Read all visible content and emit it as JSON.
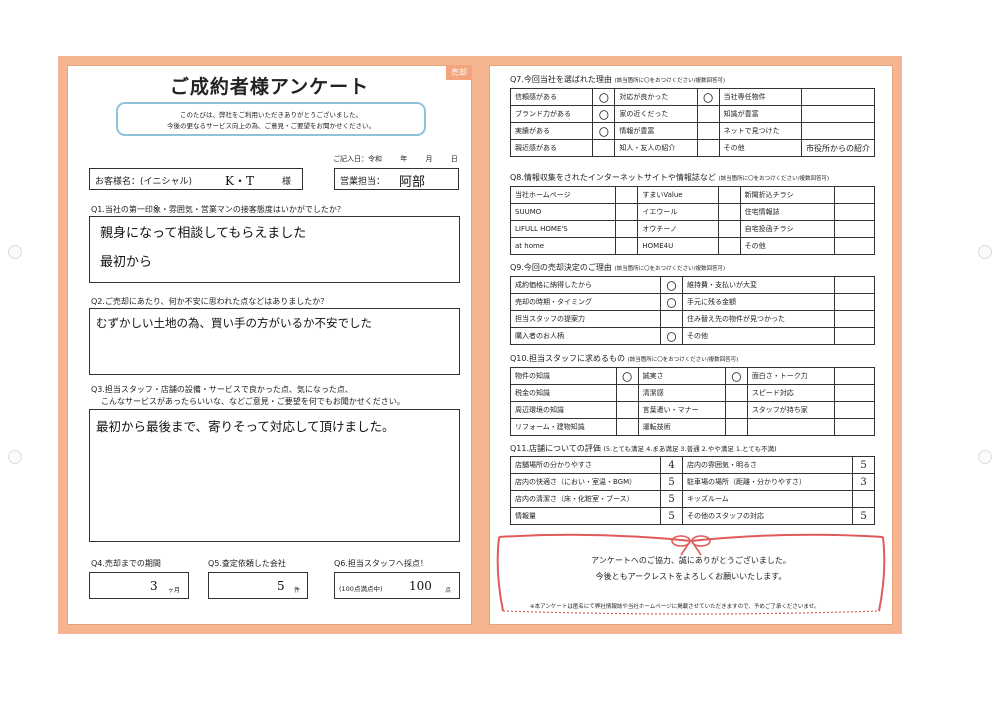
{
  "survey_title": "ご成約者様アンケート",
  "corner_tag": "売却",
  "intro": [
    "このたびは、弊社をご利用いただきありがとうございました。",
    "今後の更なるサービス向上の為、ご意見・ご要望をお聞かせください。"
  ],
  "entry_date": {
    "label": "ご記入日：令和",
    "year": "年",
    "month": "月",
    "day": "日"
  },
  "customer": {
    "label": "お客様名：(イニシャル)",
    "value": "K・T",
    "suffix": "様"
  },
  "staff": {
    "label": "営業担当：",
    "value": "阿部"
  },
  "q1": {
    "text": "Q1.当社の第一印象・雰囲気・営業マンの接客態度はいかがでしたか？",
    "answer": [
      "親身になって相談してもらえました",
      "最初から"
    ]
  },
  "q2": {
    "text": "Q2.ご売却にあたり、何か不安に思われた点などはありましたか？",
    "answer": "むずかしい土地の為、買い手の方がいるか不安でした"
  },
  "q3": {
    "text": "Q3.担当スタッフ・店舗の設備・サービスで良かった点、気になった点、",
    "text2": "こんなサービスがあったらいいな、などご意見・ご要望を何でもお聞かせください。",
    "answer": "最初から最後まで、寄りそって対応して頂けました。"
  },
  "q4": {
    "text": "Q4.売却までの期間",
    "value": "3",
    "unit": "ヶ月"
  },
  "q5": {
    "text": "Q5.査定依頼した会社",
    "value": "5",
    "unit": "件"
  },
  "q6": {
    "text": "Q6.担当スタッフへ採点！",
    "prefix": "(100点満点中)",
    "value": "100",
    "unit": "点"
  },
  "q7": {
    "text": "Q7.今回当社を選ばれた理由",
    "note": "(該当箇所に〇をおつけください/複数回答可)",
    "rows": [
      [
        "信頼感がある",
        "〇",
        "対応が良かった",
        "〇",
        "当社専任物件",
        ""
      ],
      [
        "ブランド力がある",
        "〇",
        "家の近くだった",
        "",
        "知識が豊富",
        ""
      ],
      [
        "実績がある",
        "〇",
        "情報が豊富",
        "",
        "ネットで見つけた",
        ""
      ],
      [
        "親近感がある",
        "",
        "知人・友人の紹介",
        "",
        "その他",
        "市役所からの紹介"
      ]
    ]
  },
  "q8": {
    "text": "Q8.情報収集をされたインターネットサイトや情報誌など",
    "note": "(該当箇所に〇をおつけください/複数回答可)",
    "rows": [
      [
        "当社ホームページ",
        "",
        "すまいValue",
        "",
        "新聞折込チラシ",
        ""
      ],
      [
        "SUUMO",
        "",
        "イエウール",
        "",
        "住宅情報誌",
        ""
      ],
      [
        "LIFULL HOME'S",
        "",
        "オウチーノ",
        "",
        "自宅投函チラシ",
        ""
      ],
      [
        "at home",
        "",
        "HOME4U",
        "",
        "その他",
        ""
      ]
    ]
  },
  "q9": {
    "text": "Q9.今回の売却決定のご理由",
    "note": "(該当箇所に〇をおつけください/複数回答可)",
    "rows": [
      [
        "成約価格に納得したから",
        "〇",
        "維持費・支払いが大変",
        ""
      ],
      [
        "売却の時期・タイミング",
        "〇",
        "手元に残る金額",
        ""
      ],
      [
        "担当スタッフの提案力",
        "",
        "住み替え先の物件が見つかった",
        ""
      ],
      [
        "購入者のお人柄",
        "〇",
        "その他",
        ""
      ]
    ]
  },
  "q10": {
    "text": "Q10.担当スタッフに求めるもの",
    "note": "(該当箇所に〇をおつけください/複数回答可)",
    "rows": [
      [
        "物件の知識",
        "〇",
        "誠実さ",
        "〇",
        "面白さ・トーク力",
        ""
      ],
      [
        "税金の知識",
        "",
        "清潔感",
        "",
        "スピード対応",
        ""
      ],
      [
        "周辺環境の知識",
        "",
        "言葉遣い・マナー",
        "",
        "スタッフが持ち家",
        ""
      ],
      [
        "リフォーム・建物知識",
        "",
        "運転技術",
        "",
        "",
        ""
      ]
    ]
  },
  "q11": {
    "text": "Q11.店舗についての評価",
    "scale": "(5.とても満足 4.まあ満足 3.普通 2.やや満足 1.とても不満)",
    "rows": [
      [
        "店舗場所の分かりやすさ",
        "4",
        "店内の雰囲気・明るさ",
        "5"
      ],
      [
        "店内の快適さ（におい・室温・BGM）",
        "5",
        "駐車場の場所（距離・分かりやすさ）",
        "3"
      ],
      [
        "店内の清潔さ（床・化粧室・ブース）",
        "5",
        "キッズルーム",
        ""
      ],
      [
        "情報量",
        "5",
        "その他のスタッフの対応",
        "5"
      ]
    ]
  },
  "thanks": [
    "アンケートへのご協力、誠にありがとうございました。",
    "今後ともアークレストをよろしくお願いいたします。"
  ],
  "footnote": "※本アンケートは匿名にて弊社情報誌や当社ホームページに掲載させていただきますので、予めご了承くださいませ。",
  "colors": {
    "frame": "#f6b591",
    "intro_border": "#8ec3dc",
    "ribbon": "#e05a5a"
  }
}
